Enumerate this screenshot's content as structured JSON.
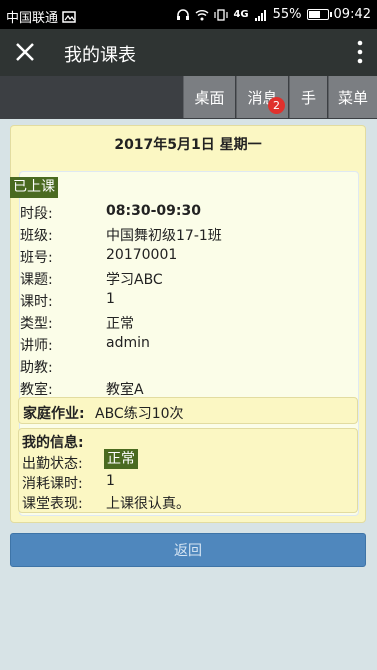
{
  "status": {
    "carrier": "中国联通",
    "network": "4G",
    "battery": "55%",
    "time": "09:42"
  },
  "appbar": {
    "title": "我的课表"
  },
  "toolbar": {
    "buttons": [
      "桌面",
      "消息",
      "手",
      "菜单"
    ],
    "message_badge": "2"
  },
  "schedule": {
    "date": "2017年5月1日 星期一",
    "status_tag": "已上课",
    "fields": [
      {
        "label": "时段:",
        "value": "08:30-09:30"
      },
      {
        "label": "班级:",
        "value": "中国舞初级17-1班"
      },
      {
        "label": "班号:",
        "value": "20170001"
      },
      {
        "label": "课题:",
        "value": "学习ABC"
      },
      {
        "label": "课时:",
        "value": "1"
      },
      {
        "label": "类型:",
        "value": "正常"
      },
      {
        "label": "讲师:",
        "value": "admin"
      },
      {
        "label": "助教:",
        "value": ""
      },
      {
        "label": "教室:",
        "value": "教室A"
      }
    ],
    "homework": {
      "label": "家庭作业:",
      "value": "ABC练习10次"
    },
    "my_info": {
      "title": "我的信息:",
      "attendance_label": "出勤状态:",
      "attendance_value": "正常",
      "consumed_label": "消耗课时:",
      "consumed_value": "1",
      "performance_label": "课堂表现:",
      "performance_value": "上课很认真。"
    }
  },
  "back_label": "返回"
}
